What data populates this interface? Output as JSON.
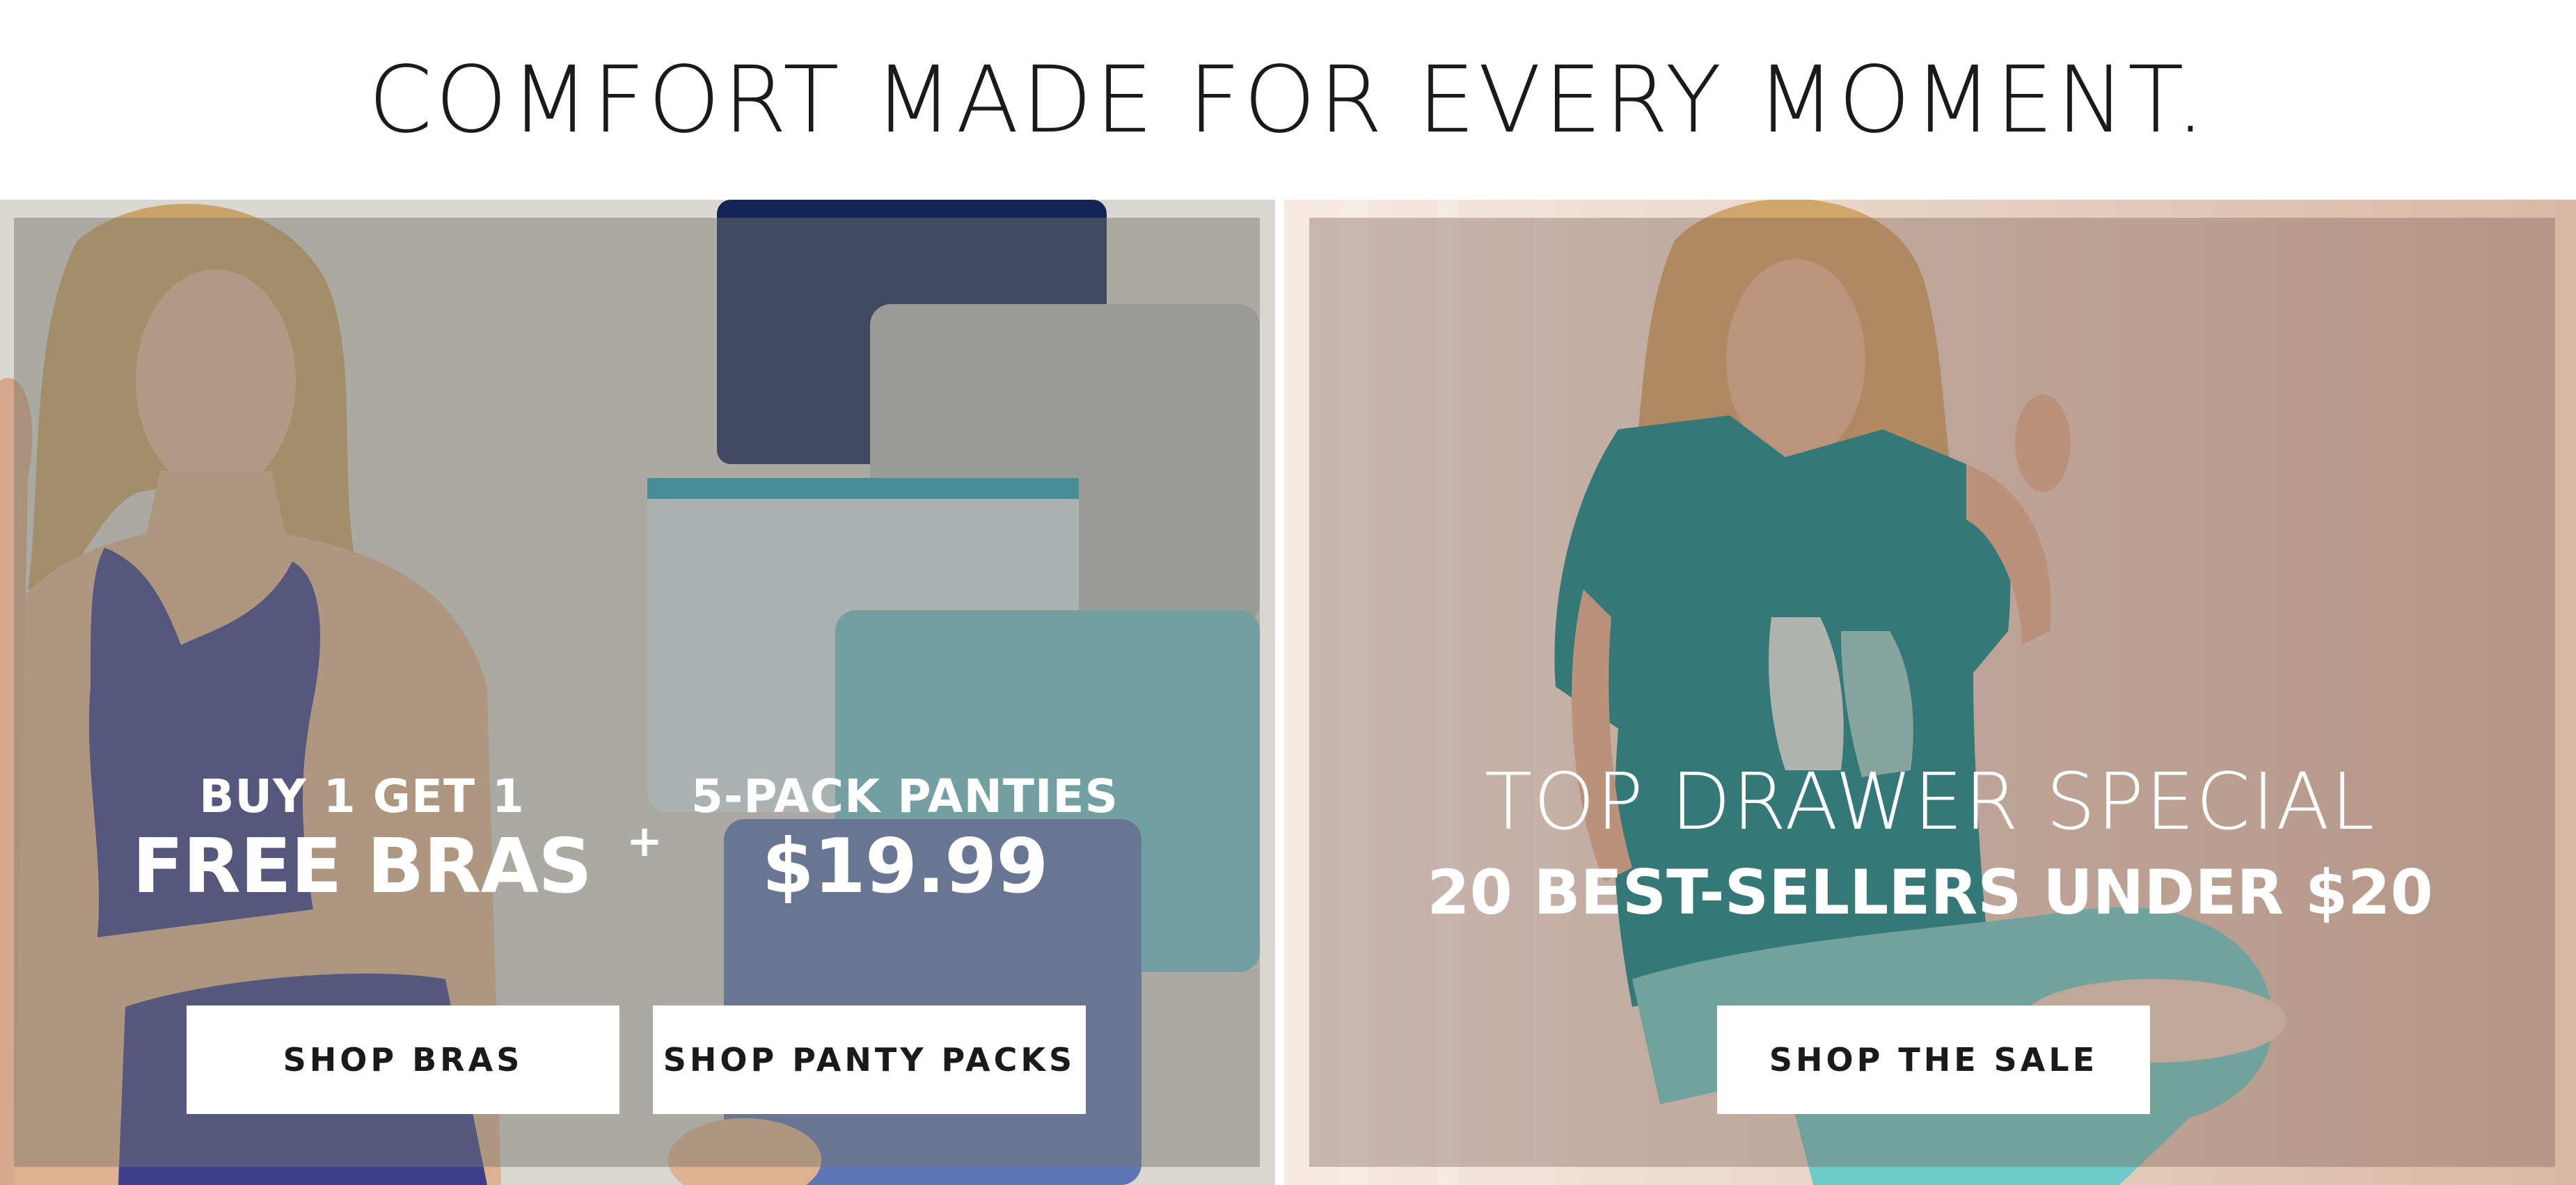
{
  "headline": "COMFORT MADE FOR EVERY MOMENT.",
  "left_panel": {
    "offer_1": {
      "line_1": "BUY 1 GET 1",
      "line_2": "FREE BRAS"
    },
    "plus": "+",
    "offer_2": {
      "line_1": "5-PACK PANTIES",
      "line_2": "$19.99"
    },
    "buttons": {
      "shop_bras": "SHOP BRAS",
      "shop_panty_packs": "SHOP PANTY PACKS"
    }
  },
  "right_panel": {
    "title": "TOP DRAWER SPECIAL",
    "subtitle": "20 BEST-SELLERS UNDER $20",
    "button": "SHOP THE SALE"
  },
  "colors": {
    "text_dark": "#1a1a1a",
    "overlay_text": "#ffffff",
    "button_bg": "#ffffff"
  }
}
